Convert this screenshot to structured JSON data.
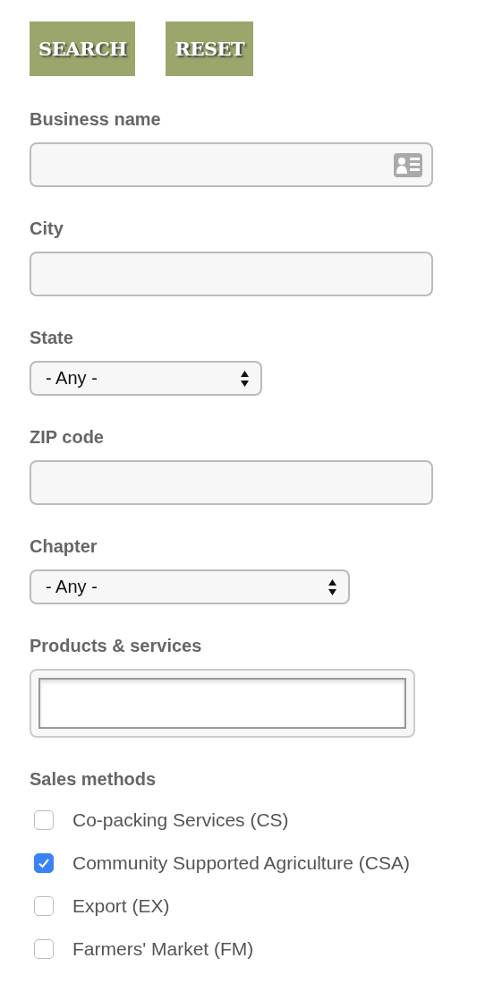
{
  "buttons": [
    "SEARCH",
    "RESET"
  ],
  "fields": [
    {
      "label": "Business name",
      "kind": "text-card"
    },
    {
      "label": "City",
      "kind": "text"
    },
    {
      "label": "State",
      "kind": "select",
      "value": "- Any -"
    },
    {
      "label": "ZIP code",
      "kind": "text"
    },
    {
      "label": "Chapter",
      "kind": "select-wide",
      "value": "- Any -"
    },
    {
      "label": "Products & services",
      "kind": "framed"
    }
  ],
  "sales_methods": {
    "label": "Sales methods",
    "options": [
      {
        "label": "Co-packing Services (CS)",
        "checked": false
      },
      {
        "label": "Community Supported Agriculture (CSA)",
        "checked": true
      },
      {
        "label": "Export (EX)",
        "checked": false
      },
      {
        "label": "Farmers' Market (FM)",
        "checked": false
      }
    ]
  }
}
